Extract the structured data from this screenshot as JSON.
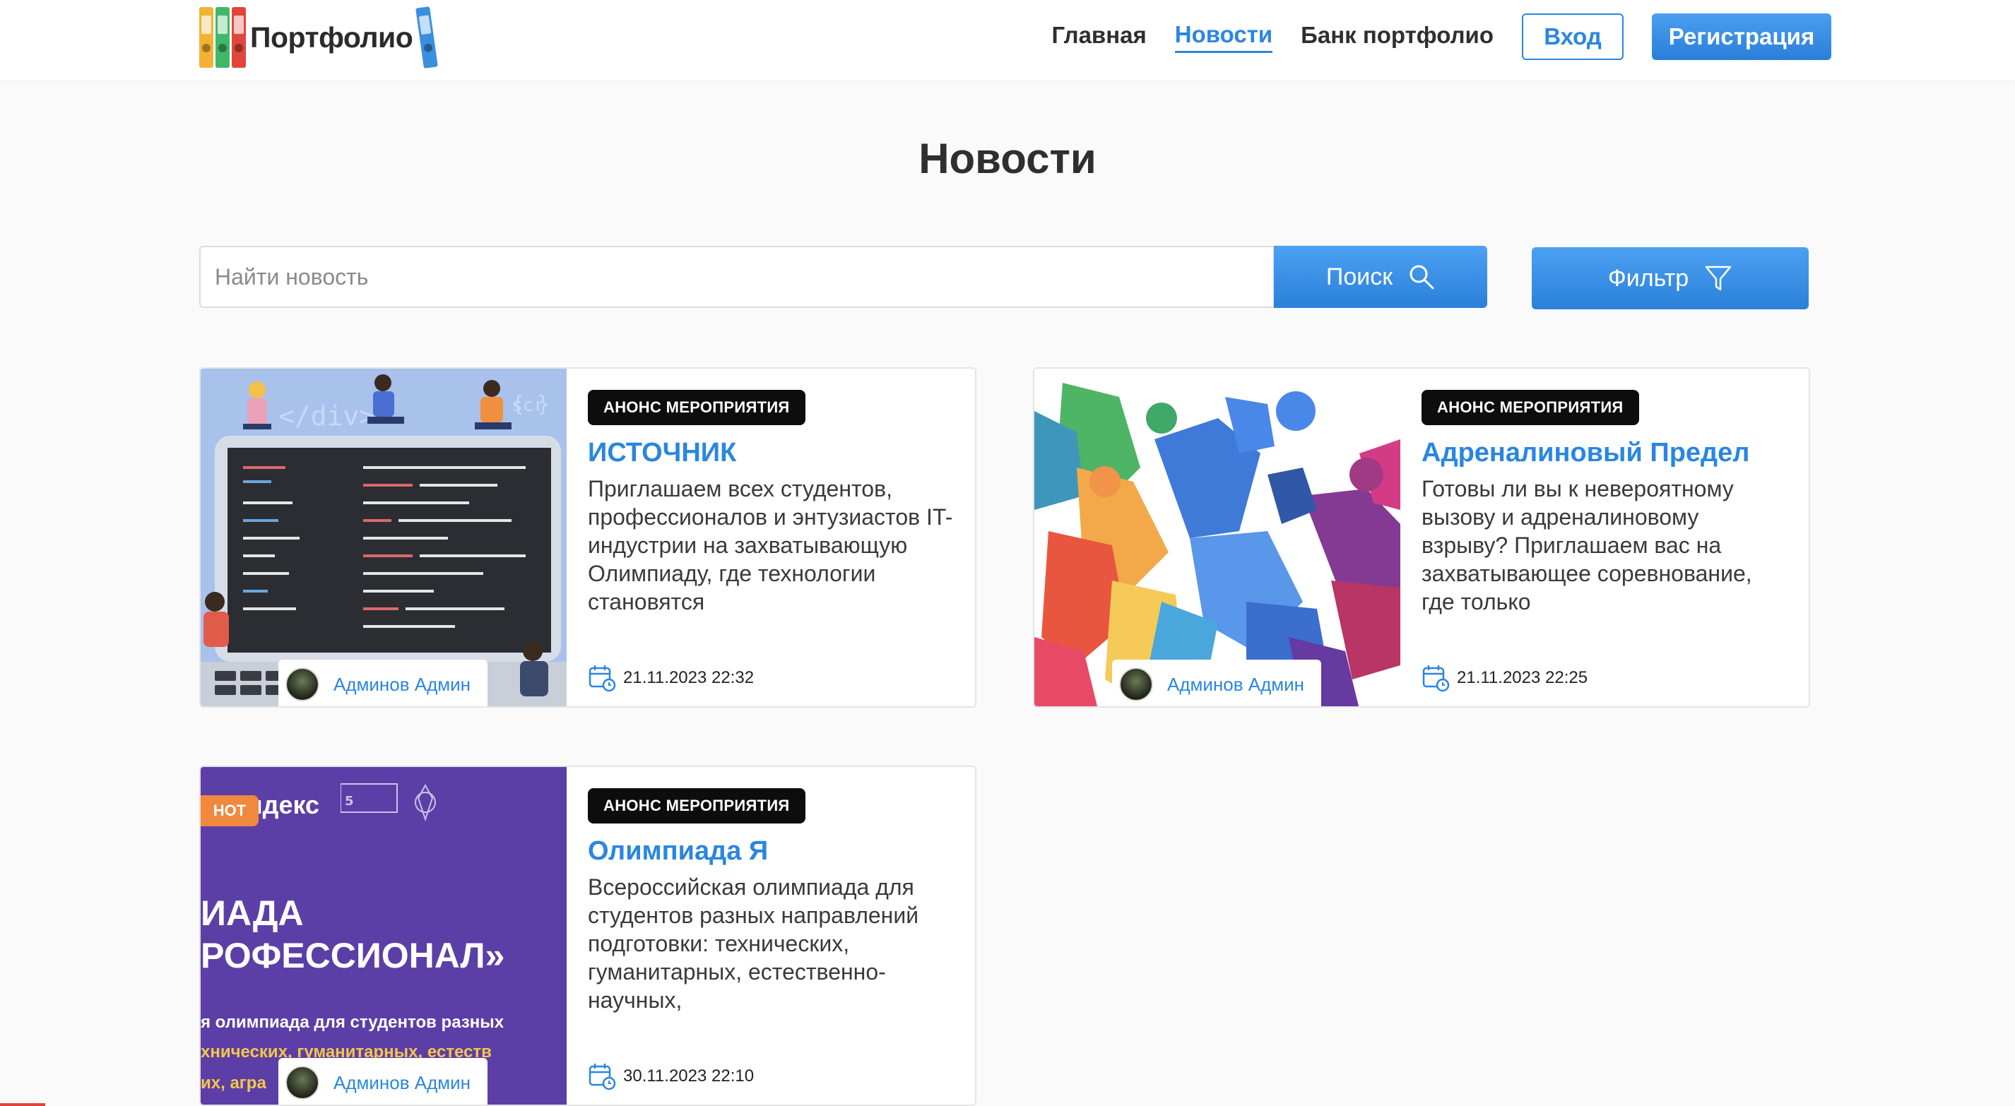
{
  "header": {
    "logo_text": "Портфолио",
    "nav": [
      {
        "label": "Главная",
        "active": false
      },
      {
        "label": "Новости",
        "active": true
      },
      {
        "label": "Банк портфолио",
        "active": false
      }
    ],
    "login_label": "Вход",
    "register_label": "Регистрация"
  },
  "page": {
    "title": "Новости"
  },
  "search": {
    "placeholder": "Найти новость",
    "button_label": "Поиск",
    "filter_label": "Фильтр"
  },
  "news": [
    {
      "tag": "АНОНС МЕРОПРИЯТИЯ",
      "title": "ИСТОЧНИК",
      "text": "Приглашаем всех студентов, профессионалов и энтузиастов IT-индустрии на захватывающую Олимпиаду, где технологии становятся",
      "author": "Админов Админ",
      "date": "21.11.2023 22:32",
      "hot": false
    },
    {
      "tag": "АНОНС МЕРОПРИЯТИЯ",
      "title": "Адреналиновый Предел",
      "text": "Готовы ли вы к невероятному вызову и адреналиновому взрыву? Приглашаем вас на захватывающее соревнование, где только",
      "author": "Админов Админ",
      "date": "21.11.2023 22:25",
      "hot": false
    },
    {
      "tag": "АНОНС МЕРОПРИЯТИЯ",
      "title": "Олимпиада Я",
      "text": "Всероссийская олимпиада для студентов разных направлений подготовки: технических, гуманитарных, естественно-научных,",
      "author": "Админов Админ",
      "date": "30.11.2023 22:10",
      "hot": true,
      "hot_label": "HOT",
      "image_text": {
        "brand": "Яндекс",
        "line1": "ИАДА",
        "line2": "РОФЕССИОНАЛ»",
        "line3": "я олимпиада для студентов разных",
        "line4": "хнических, гуманитарных, естеств",
        "line5": "их, агра"
      }
    }
  ],
  "colors": {
    "accent": "#2a86e0",
    "tag_bg": "#0d0d0d",
    "hot": "#f0883e",
    "olympiad_bg": "#5b3fa6"
  }
}
